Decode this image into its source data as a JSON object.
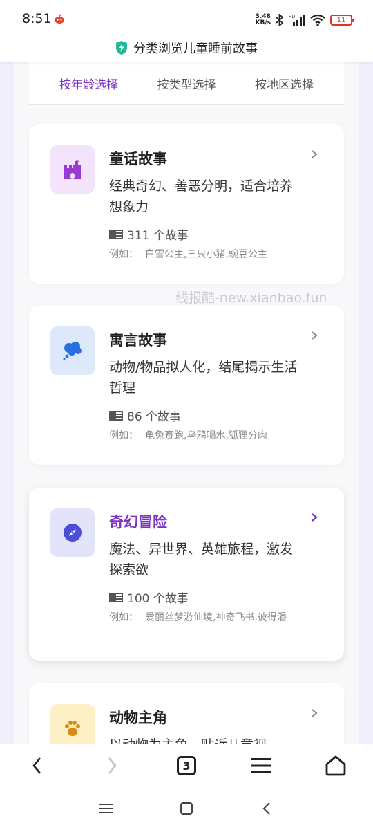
{
  "status_bar": {
    "time": "8:51",
    "net_speed_value": "3.48",
    "net_speed_unit": "KB/s",
    "battery": "11"
  },
  "title_bar": {
    "title": "分类浏览儿童睡前故事",
    "shield_color": "#1fb89a"
  },
  "tabs": [
    {
      "label": "按年龄选择",
      "active": true
    },
    {
      "label": "按类型选择",
      "active": false
    },
    {
      "label": "按地区选择",
      "active": false
    }
  ],
  "categories": [
    {
      "title": "童话故事",
      "description": "经典奇幻、善恶分明，适合培养想象力",
      "count": "311 个故事",
      "examples_label": "例如：",
      "examples": "白雪公主,三只小猪,豌豆公主",
      "icon": "castle-icon",
      "icon_bg": "#f3e3fb",
      "icon_color": "#9a3ad6"
    },
    {
      "title": "寓言故事",
      "description": "动物/物品拟人化，结尾揭示生活哲理",
      "count": "86 个故事",
      "examples_label": "例如：",
      "examples": "龟兔赛跑,乌鸦喝水,狐狸分肉",
      "icon": "thought-cloud-icon",
      "icon_bg": "#dde9fb",
      "icon_color": "#2a6fe0"
    },
    {
      "title": "奇幻冒险",
      "description": "魔法、异世界、英雄旅程，激发探索欲",
      "count": "100 个故事",
      "examples_label": "例如：",
      "examples": "爱丽丝梦游仙境,神奇飞书,彼得潘",
      "icon": "compass-icon",
      "icon_bg": "#e2e4fa",
      "icon_color": "#4a4fd6",
      "selected": true
    },
    {
      "title": "动物主角",
      "description": "以动物为主角，贴近儿童视",
      "icon": "paw-icon",
      "icon_bg": "#fdf0c6",
      "icon_color": "#d98a12"
    }
  ],
  "watermark": "线报酷-new.xianbao.fun",
  "browser_nav": {
    "tab_count": "3"
  },
  "colors": {
    "accent": "#7b32c2"
  }
}
